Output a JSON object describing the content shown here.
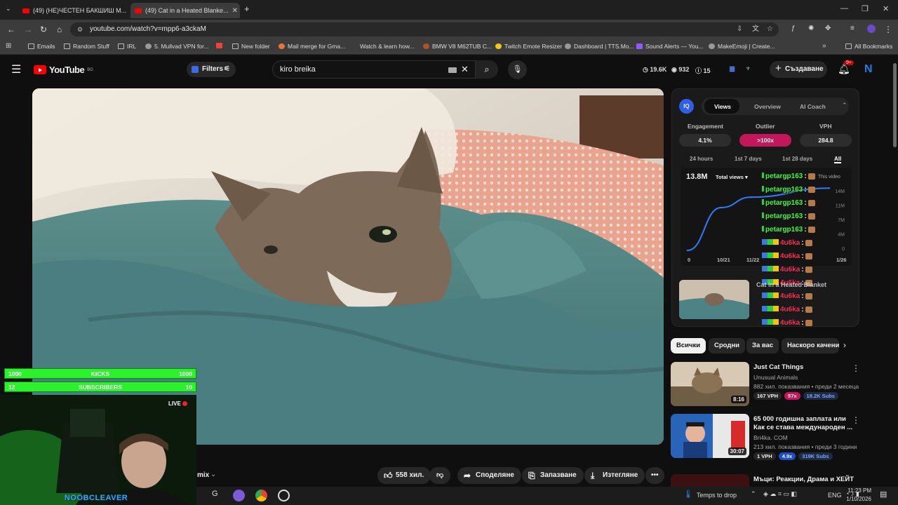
{
  "browser": {
    "tabs": [
      {
        "label": "(49) (НЕ)ЧЕСТЕН БАКШИШ М..."
      },
      {
        "label": "(49) Cat in a Heated Blanke..."
      }
    ],
    "url": "youtube.com/watch?v=mpp6-a3ckaM",
    "bookmarks": [
      "Emails",
      "Random Stuff",
      "IRL",
      "5. Mullvad VPN for...",
      "New folder",
      "Mail merge for Gma...",
      "Watch & learn how...",
      "BMW V8 M62TUB C...",
      "Twitch Emote Resizer",
      "Dashboard | TTS.Mo...",
      "Sound Alerts — You...",
      "MakeEmoji | Create...",
      "All Bookmarks"
    ]
  },
  "yt_header": {
    "logo": "YouTube",
    "logo_region": "BG",
    "filters": "Filters",
    "search_value": "kiro breika",
    "stats": {
      "eye": "19.6K",
      "views": "932",
      "count": "15"
    },
    "create": "Създаване",
    "bell_badge": "9+",
    "avatar": "N"
  },
  "iq": {
    "logo": "IQ",
    "tabs": [
      "Views",
      "Overview",
      "AI Coach"
    ],
    "metrics": [
      {
        "label": "Engagement",
        "value": "4.1%"
      },
      {
        "label": "Outlier",
        "value": ">100x"
      },
      {
        "label": "VPH",
        "value": "284.8"
      }
    ],
    "ranges": [
      "24 hours",
      "1st 7 days",
      "1st 28 days",
      "All"
    ],
    "total": "13.8M",
    "total_dropdown": "Total views",
    "x_ticks": [
      "0",
      "10/21",
      "11/22",
      "1/26"
    ],
    "y_ticks": [
      "14M",
      "11M",
      "7M",
      "4M",
      "0"
    ],
    "legend": "This video",
    "colors": {
      "accent": "#c2185b",
      "line": "#2f7df6"
    }
  },
  "chart_data": {
    "type": "line",
    "title": "",
    "xlabel": "",
    "ylabel": "",
    "x": [
      "0",
      "10/21",
      "11/22",
      "1/26"
    ],
    "series": [
      {
        "name": "This video",
        "values": [
          0,
          9.5,
          11.8,
          13.8
        ]
      }
    ],
    "ylim": [
      0,
      14
    ]
  },
  "chips": [
    "Всички",
    "Сродни",
    "За вас",
    "Наскоро качени"
  ],
  "recs": [
    {
      "title": "Just Cat Things",
      "channel": "Unusual Animals",
      "meta": "882 хил. показвания • преди 2 месеца",
      "duration": "8:16",
      "vph": "167 VPH",
      "outlier": "57x",
      "subs": "18.2K Subs"
    },
    {
      "title": "65 000 годишна заплата или Как се става международен ...",
      "channel": "Bri4ka. COM",
      "meta": "213 хил. показвания • преди 3 години",
      "duration": "30:07",
      "vph": "1 VPH",
      "outlier": "4.9x",
      "subs": "319K Subs"
    },
    {
      "title": "Мъци: Реакции, Драма и ХЕЙТ",
      "channel": "",
      "meta": "",
      "duration": "",
      "vph": "",
      "outlier": "",
      "subs": ""
    }
  ],
  "actions": {
    "partial": "mix",
    "likes": "558 хил.",
    "share": "Споделяне",
    "save": "Запазване",
    "download": "Изтегляне"
  },
  "overlay": {
    "kicks": {
      "left": "1000",
      "label": "KICKS",
      "right": "1000"
    },
    "subs": {
      "left": "12",
      "label": "SUBSCRIBERS",
      "right": "10"
    },
    "live": "LIVE",
    "streamer": "NOOBCLEAVER"
  },
  "chat": [
    {
      "user": "petargp163",
      "color": "#3dff3d"
    },
    {
      "user": "petargp163",
      "color": "#3dff3d"
    },
    {
      "user": "petargp163",
      "color": "#3dff3d"
    },
    {
      "user": "petargp163",
      "color": "#3dff3d"
    },
    {
      "user": "petargp163",
      "color": "#3dff3d"
    },
    {
      "user": "4u6ka",
      "color": "#ff2e5a"
    },
    {
      "user": "4u6ka",
      "color": "#ff2e5a"
    },
    {
      "user": "4u6ka",
      "color": "#ff2e5a"
    },
    {
      "user": "4u6ka",
      "color": "#ff2e5a"
    },
    {
      "user": "4u6ka",
      "color": "#ff2e5a"
    },
    {
      "user": "4u6ka",
      "color": "#ff2e5a"
    },
    {
      "user": "4u6ka",
      "color": "#ff2e5a"
    }
  ],
  "chat_underlay": "Cat in a Heated Blanket",
  "taskbar": {
    "drop": "Temps to drop",
    "lang": "ENG",
    "time": "11:23 PM",
    "date": "1/10/2026"
  }
}
